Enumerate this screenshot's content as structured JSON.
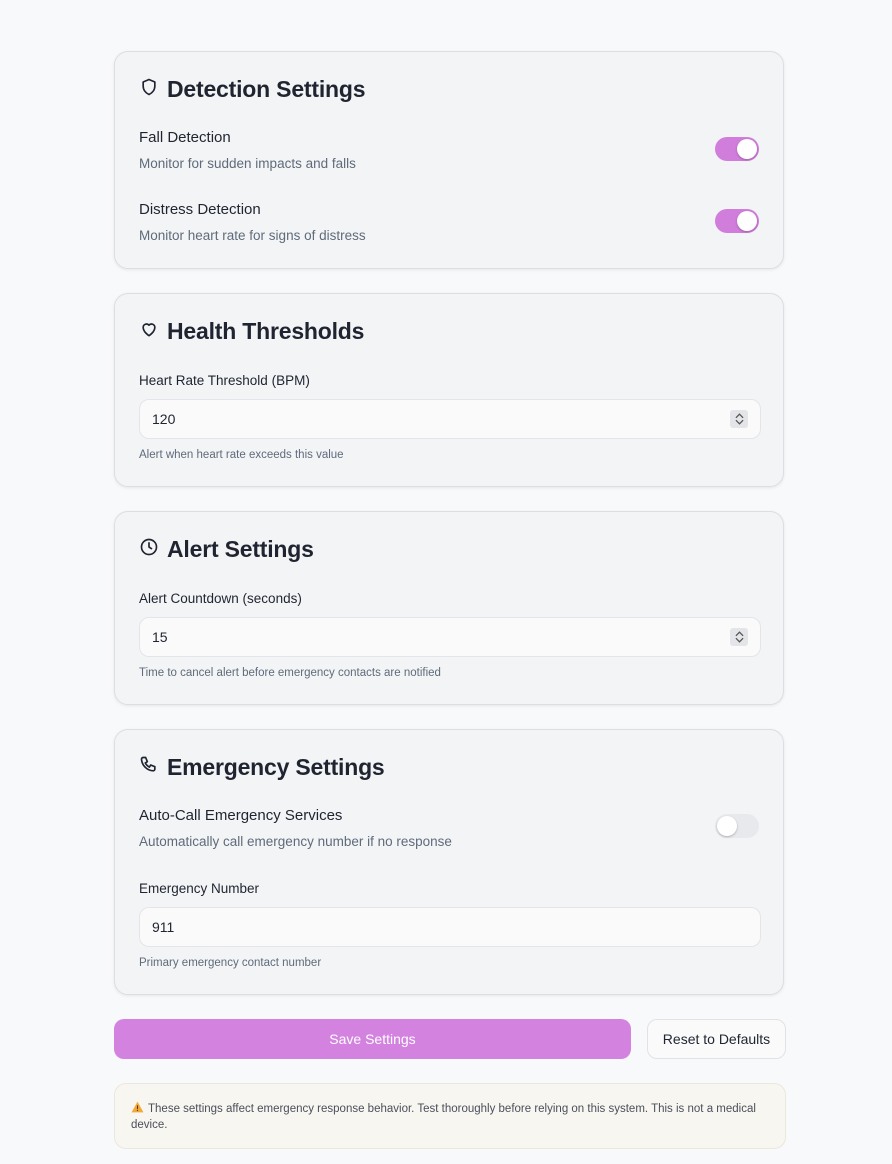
{
  "detection": {
    "title": "Detection Settings",
    "icon": "shield-icon",
    "fall": {
      "title": "Fall Detection",
      "desc": "Monitor for sudden impacts and falls",
      "enabled": true
    },
    "distress": {
      "title": "Distress Detection",
      "desc": "Monitor heart rate for signs of distress",
      "enabled": true
    }
  },
  "health": {
    "title": "Health Thresholds",
    "icon": "heart-icon",
    "heart_rate": {
      "label": "Heart Rate Threshold (BPM)",
      "value": "120",
      "help": "Alert when heart rate exceeds this value"
    }
  },
  "alert": {
    "title": "Alert Settings",
    "icon": "clock-icon",
    "countdown": {
      "label": "Alert Countdown (seconds)",
      "value": "15",
      "help": "Time to cancel alert before emergency contacts are notified"
    }
  },
  "emergency": {
    "title": "Emergency Settings",
    "icon": "phone-icon",
    "auto_call": {
      "title": "Auto-Call Emergency Services",
      "desc": "Automatically call emergency number if no response",
      "enabled": false
    },
    "number": {
      "label": "Emergency Number",
      "value": "911",
      "help": "Primary emergency contact number"
    }
  },
  "actions": {
    "save_label": "Save Settings",
    "reset_label": "Reset to Defaults"
  },
  "warning": {
    "icon": "warning-icon",
    "text": "These settings affect emergency response behavior. Test thoroughly before relying on this system. This is not a medical device."
  },
  "colors": {
    "accent": "#d382e0",
    "toggle_on": "#d07ddb",
    "toggle_off": "#e8e9ed"
  }
}
